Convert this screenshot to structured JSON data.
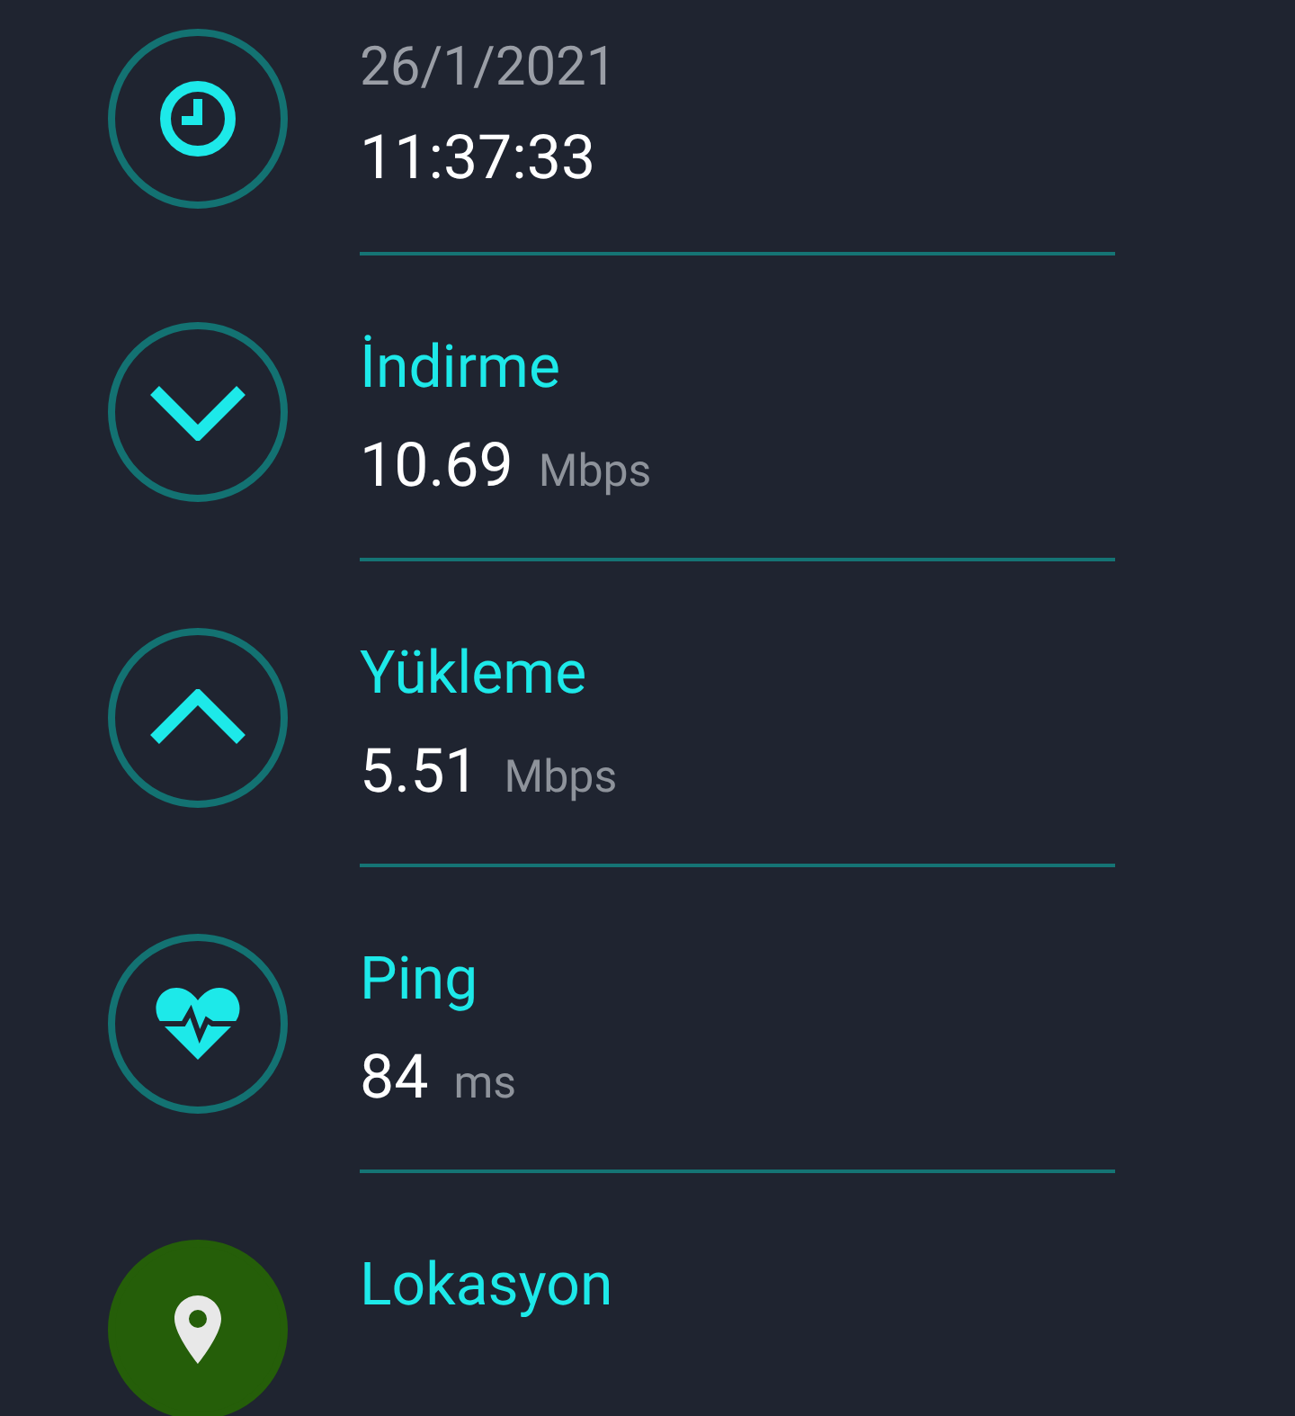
{
  "results": [
    {
      "kind": "datetime",
      "date": "26/1/2021",
      "time": "11:37:33"
    },
    {
      "kind": "download",
      "label": "İndirme",
      "value": "10.69",
      "unit": "Mbps"
    },
    {
      "kind": "upload",
      "label": "Yükleme",
      "value": "5.51",
      "unit": "Mbps"
    },
    {
      "kind": "ping",
      "label": "Ping",
      "value": "84",
      "unit": "ms"
    },
    {
      "kind": "location",
      "label": "Lokasyon"
    }
  ]
}
